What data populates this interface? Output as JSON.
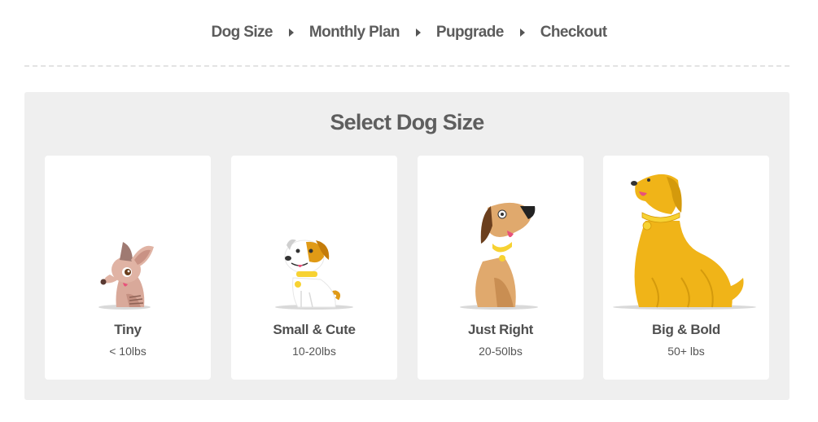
{
  "steps": [
    "Dog Size",
    "Monthly Plan",
    "Pupgrade",
    "Checkout"
  ],
  "panel": {
    "title": "Select Dog Size"
  },
  "cards": [
    {
      "label": "Tiny",
      "range": "< 10lbs",
      "icon": "chihuahua-icon"
    },
    {
      "label": "Small & Cute",
      "range": "10-20lbs",
      "icon": "terrier-icon"
    },
    {
      "label": "Just Right",
      "range": "20-50lbs",
      "icon": "hound-icon"
    },
    {
      "label": "Big & Bold",
      "range": "50+ lbs",
      "icon": "golden-retriever-icon"
    }
  ],
  "colors": {
    "panel": "#efefef",
    "gold": "#f0b418",
    "text": "#5c5c5c"
  }
}
